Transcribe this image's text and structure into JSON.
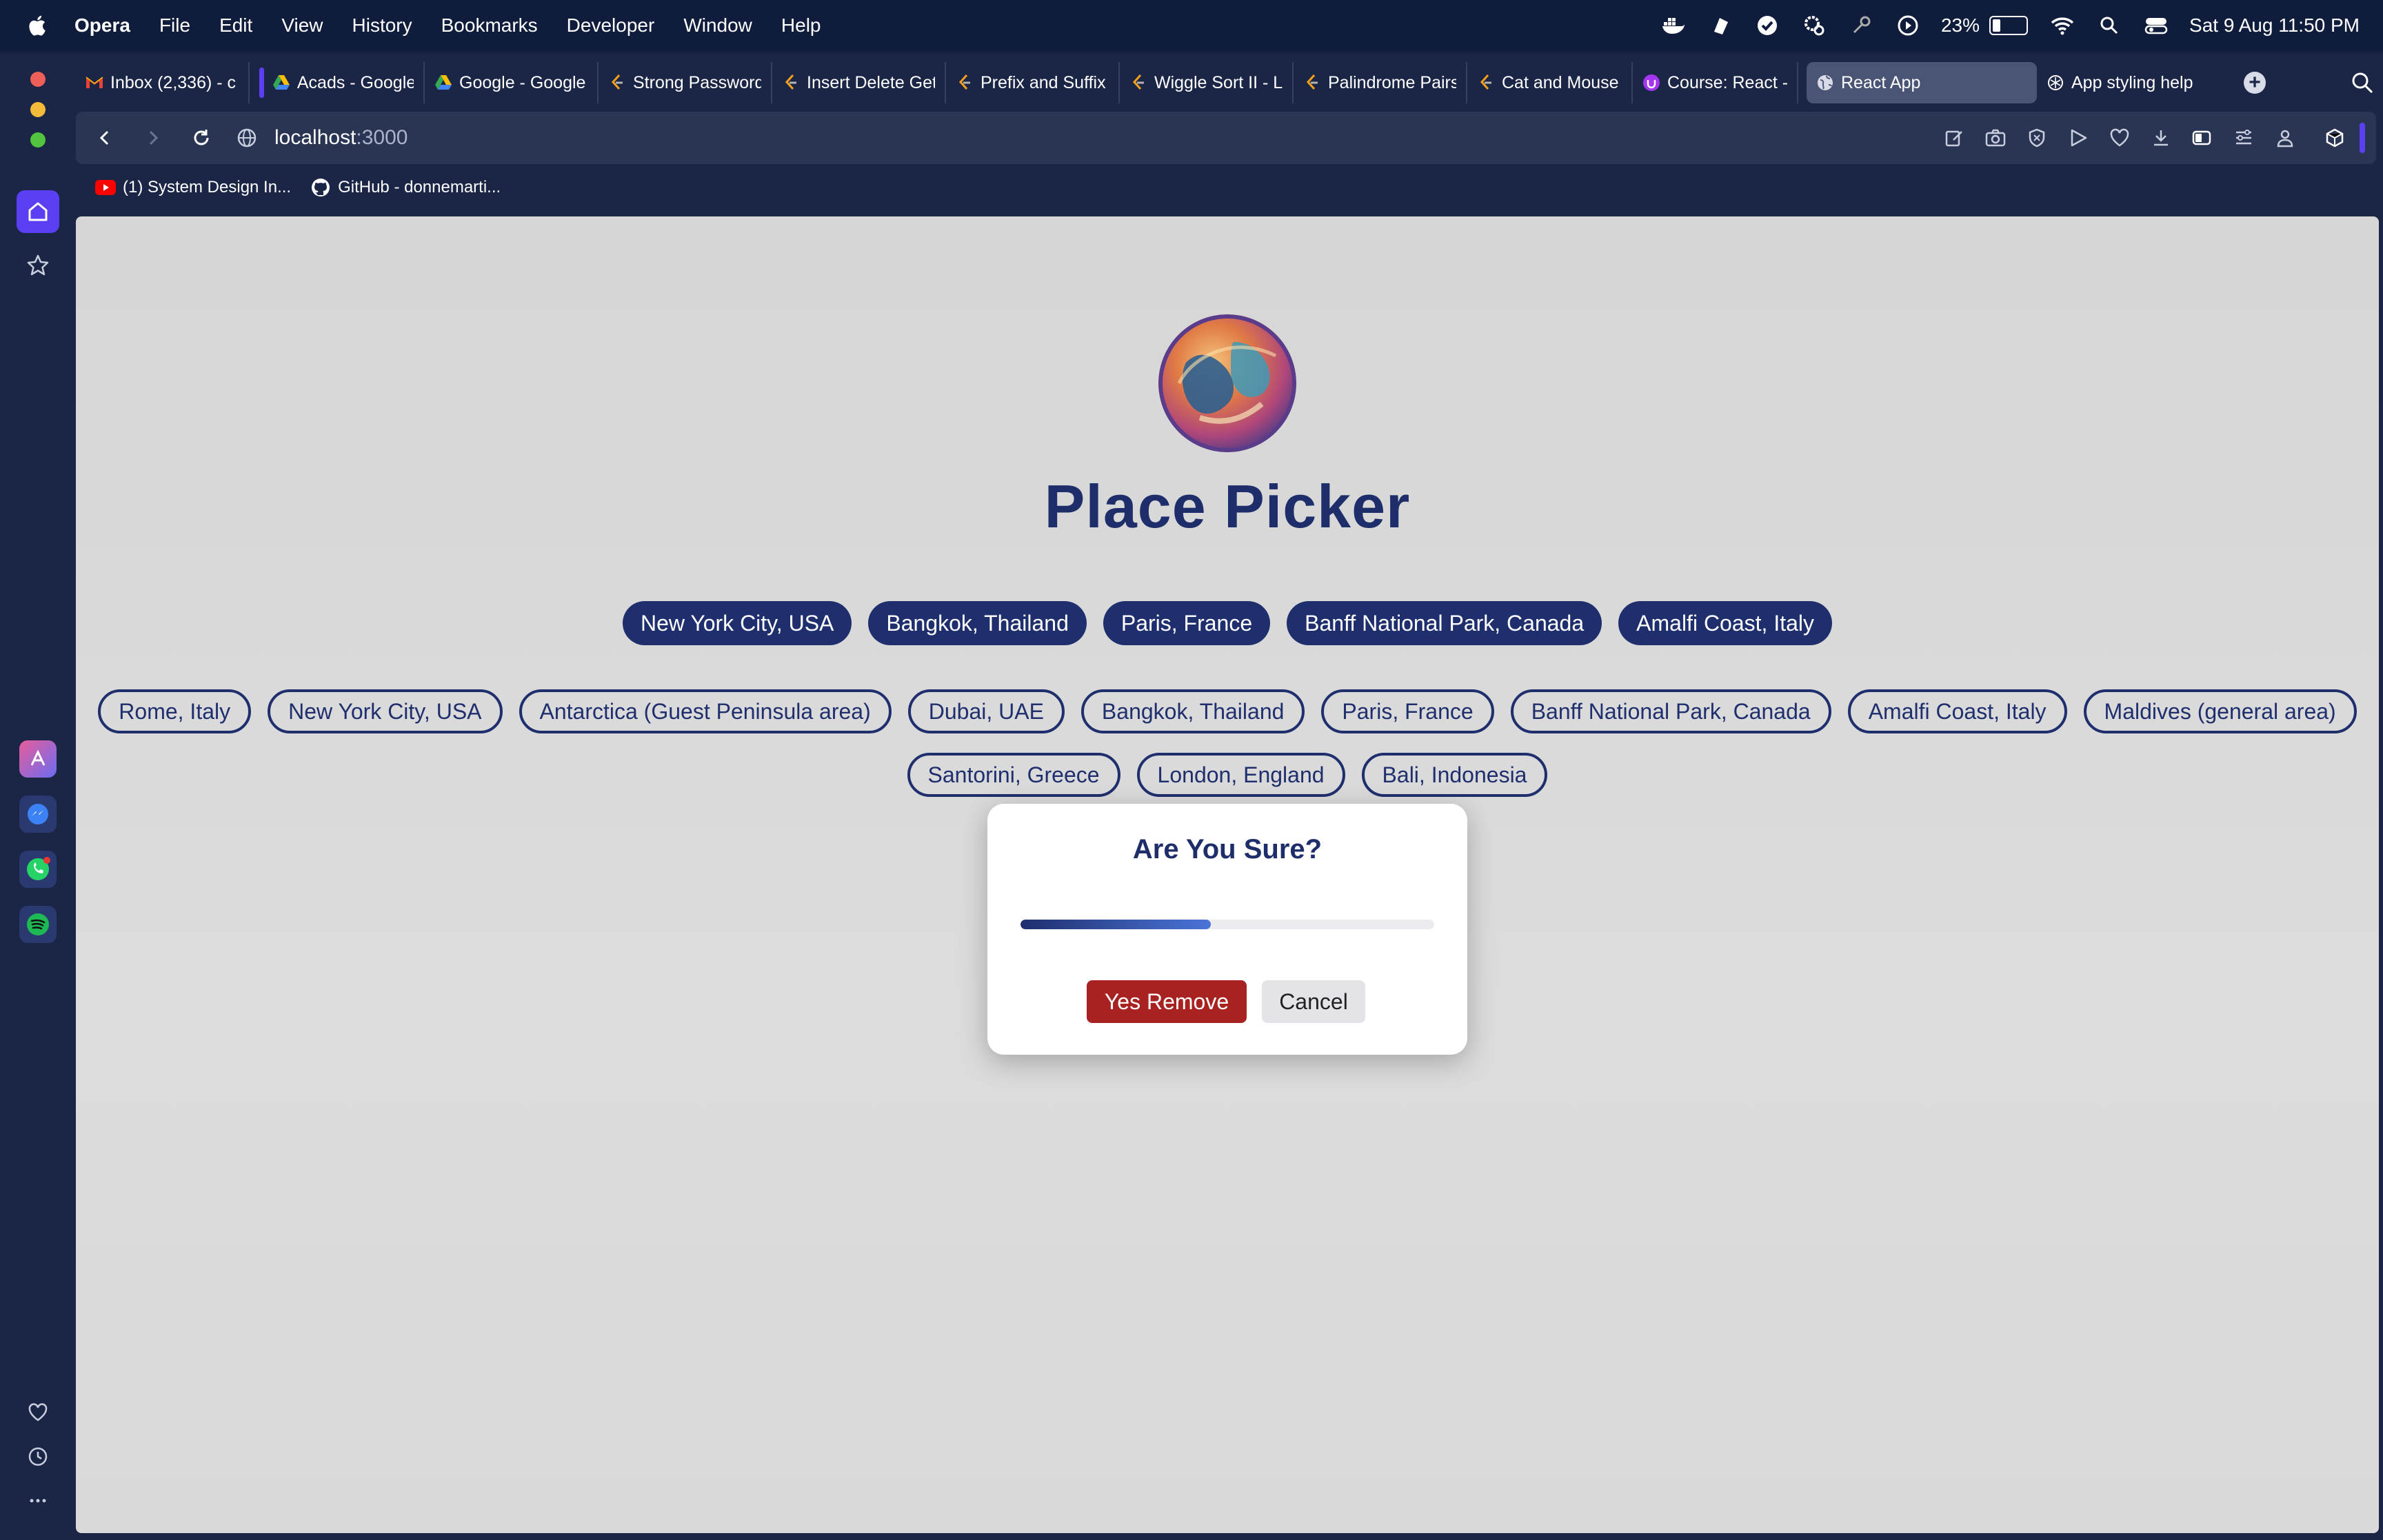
{
  "menubar": {
    "items": [
      "Opera",
      "File",
      "Edit",
      "View",
      "History",
      "Bookmarks",
      "Developer",
      "Window",
      "Help"
    ],
    "battery": "23%",
    "datetime": "Sat 9 Aug  11:50 PM",
    "status_icons": [
      "docker-icon",
      "app-icon",
      "check-icon",
      "gear-icon",
      "key-icon",
      "play-icon"
    ]
  },
  "tabs": [
    {
      "title": "Inbox (2,336) - c",
      "icon": "gmail-icon"
    },
    {
      "title": "Acads - Google D",
      "icon": "drive-icon"
    },
    {
      "title": "Google - Google",
      "icon": "drive-icon"
    },
    {
      "title": "Strong Password",
      "icon": "leetcode-icon"
    },
    {
      "title": "Insert Delete Get",
      "icon": "leetcode-icon"
    },
    {
      "title": "Prefix and Suffix",
      "icon": "leetcode-icon"
    },
    {
      "title": "Wiggle Sort II - L",
      "icon": "leetcode-icon"
    },
    {
      "title": "Palindrome Pairs",
      "icon": "leetcode-icon"
    },
    {
      "title": "Cat and Mouse -",
      "icon": "leetcode-icon"
    },
    {
      "title": "Course: React -",
      "icon": "udemy-icon"
    },
    {
      "title": "React App",
      "icon": "globe-icon",
      "active": true
    },
    {
      "title": "App styling help",
      "icon": "chatgpt-icon"
    }
  ],
  "address": {
    "host": "localhost",
    "port": ":3000"
  },
  "bookmarks": [
    {
      "label": "(1) System Design In...",
      "icon": "youtube-icon"
    },
    {
      "label": "GitHub - donnemarti...",
      "icon": "github-icon"
    }
  ],
  "app": {
    "title": "Place Picker",
    "selected_places": [
      "New York City, USA",
      "Bangkok, Thailand",
      "Paris, France",
      "Banff National Park, Canada",
      "Amalfi Coast, Italy"
    ],
    "available_places_row1": [
      "Rome, Italy",
      "New York City, USA",
      "Antarctica (Guest Peninsula area)",
      "Dubai, UAE",
      "Bangkok, Thailand",
      "Paris, France",
      "Banff National Park, Canada",
      "Amalfi Coast, Italy",
      "Maldives (general area)"
    ],
    "available_places_row2": [
      "Santorini, Greece",
      "London, England",
      "Bali, Indonesia"
    ]
  },
  "modal": {
    "title": "Are You Sure?",
    "progress": 0.46,
    "confirm_label": "Yes Remove",
    "cancel_label": "Cancel"
  },
  "colors": {
    "primary": "#1f2f6e",
    "danger": "#a82222",
    "browser_bg": "#1b2646",
    "accent": "#5b3ff2"
  }
}
